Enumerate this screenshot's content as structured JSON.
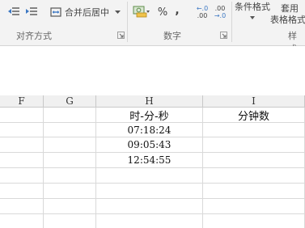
{
  "ribbon": {
    "merge_center_label": "合并后居中",
    "percent_symbol": "%",
    "comma_symbol": ",",
    "inc_decimal_top": "←.0",
    "inc_decimal_bottom": ".00",
    "dec_decimal_top": ".00",
    "dec_decimal_bottom": "→.0",
    "conditional_format_label": "条件格式",
    "table_format_label_1": "套用",
    "table_format_label_2": "表格格式",
    "groups": {
      "alignment": "对齐方式",
      "number": "数字",
      "styles": "样式"
    }
  },
  "sheet": {
    "columns": [
      "F",
      "G",
      "H",
      "I"
    ],
    "h_header": "时-分-秒",
    "i_header": "分钟数",
    "times": [
      "07:18:24",
      "09:05:43",
      "12:54:55"
    ]
  }
}
